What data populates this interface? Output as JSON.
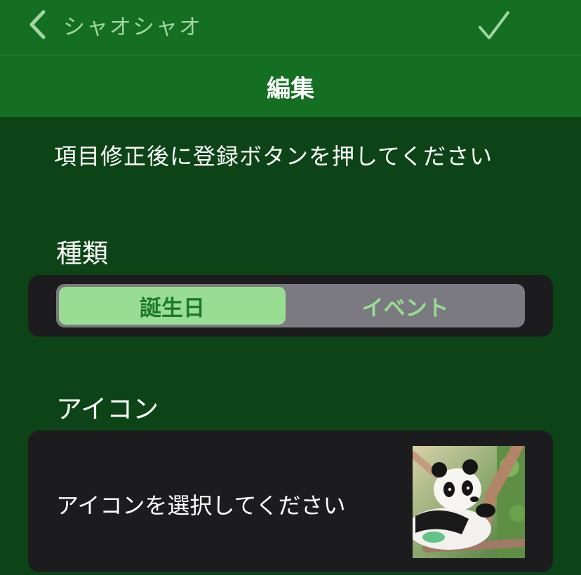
{
  "nav": {
    "back_label": "シャオシャオ",
    "title": "編集"
  },
  "instruction": "項目修正後に登録ボタンを押してください",
  "type_section": {
    "label": "種類",
    "options": [
      "誕生日",
      "イベント"
    ],
    "selected": "誕生日"
  },
  "icon_section": {
    "label": "アイコン",
    "prompt": "アイコンを選択してください",
    "image": "panda-photo"
  },
  "colors": {
    "nav_background": "#146f22",
    "page_background": "#0d4417",
    "card_background": "#1c1c1e",
    "accent_light_green": "#99dd92",
    "accent_dark_green": "#1c7a2a"
  },
  "icons": [
    "chevron-left-icon",
    "checkmark-icon"
  ]
}
